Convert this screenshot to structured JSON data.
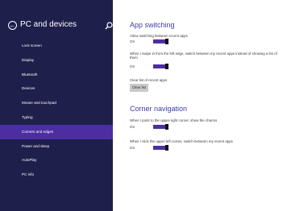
{
  "sidebar": {
    "title": "PC and devices",
    "items": [
      {
        "label": "Lock screen"
      },
      {
        "label": "Display"
      },
      {
        "label": "Bluetooth"
      },
      {
        "label": "Devices"
      },
      {
        "label": "Mouse and touchpad"
      },
      {
        "label": "Typing"
      },
      {
        "label": "Corners and edges",
        "selected": true
      },
      {
        "label": "Power and sleep"
      },
      {
        "label": "AutoPlay"
      },
      {
        "label": "PC info"
      }
    ]
  },
  "app_switching": {
    "heading": "App switching",
    "allow_label": "Allow switching between recent apps",
    "allow_state": "On",
    "swipe_label": "When I swipe in from the left edge, switch between my recent apps instead of showing a list of them",
    "swipe_state": "On",
    "clear_label": "Clear list of recent apps",
    "clear_button": "Clear list"
  },
  "corner_navigation": {
    "heading": "Corner navigation",
    "charms_label": "When I point to the upper-right corner, show the charms",
    "charms_state": "On",
    "upper_left_label": "When I click the upper-left corner, switch between my recent apps",
    "upper_left_state": "On"
  },
  "colors": {
    "sidebar_bg": "#1f1f4c",
    "accent": "#4c2ea2",
    "heading": "#3c3ca6"
  }
}
